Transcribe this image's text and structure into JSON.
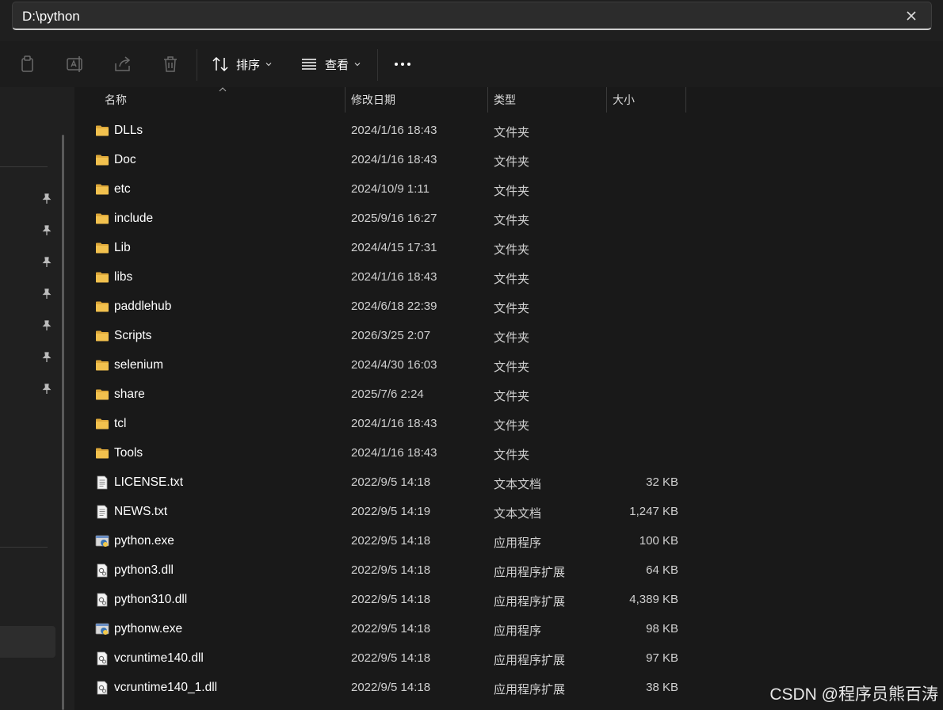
{
  "address": {
    "path": "D:\\python"
  },
  "toolbar": {
    "sort_label": "排序",
    "view_label": "查看"
  },
  "columns": [
    "名称",
    "修改日期",
    "类型",
    "大小"
  ],
  "files": [
    {
      "name": "DLLs",
      "date": "2024/1/16 18:43",
      "type": "文件夹",
      "size": "",
      "icon": "folder-icon"
    },
    {
      "name": "Doc",
      "date": "2024/1/16 18:43",
      "type": "文件夹",
      "size": "",
      "icon": "folder-icon"
    },
    {
      "name": "etc",
      "date": "2024/10/9 1:11",
      "type": "文件夹",
      "size": "",
      "icon": "folder-icon"
    },
    {
      "name": "include",
      "date": "2025/9/16 16:27",
      "type": "文件夹",
      "size": "",
      "icon": "folder-icon"
    },
    {
      "name": "Lib",
      "date": "2024/4/15 17:31",
      "type": "文件夹",
      "size": "",
      "icon": "folder-icon"
    },
    {
      "name": "libs",
      "date": "2024/1/16 18:43",
      "type": "文件夹",
      "size": "",
      "icon": "folder-icon"
    },
    {
      "name": "paddlehub",
      "date": "2024/6/18 22:39",
      "type": "文件夹",
      "size": "",
      "icon": "folder-icon"
    },
    {
      "name": "Scripts",
      "date": "2026/3/25 2:07",
      "type": "文件夹",
      "size": "",
      "icon": "folder-icon"
    },
    {
      "name": "selenium",
      "date": "2024/4/30 16:03",
      "type": "文件夹",
      "size": "",
      "icon": "folder-icon"
    },
    {
      "name": "share",
      "date": "2025/7/6 2:24",
      "type": "文件夹",
      "size": "",
      "icon": "folder-icon"
    },
    {
      "name": "tcl",
      "date": "2024/1/16 18:43",
      "type": "文件夹",
      "size": "",
      "icon": "folder-icon"
    },
    {
      "name": "Tools",
      "date": "2024/1/16 18:43",
      "type": "文件夹",
      "size": "",
      "icon": "folder-icon"
    },
    {
      "name": "LICENSE.txt",
      "date": "2022/9/5 14:18",
      "type": "文本文档",
      "size": "32 KB",
      "icon": "text-file-icon"
    },
    {
      "name": "NEWS.txt",
      "date": "2022/9/5 14:19",
      "type": "文本文档",
      "size": "1,247 KB",
      "icon": "text-file-icon"
    },
    {
      "name": "python.exe",
      "date": "2022/9/5 14:18",
      "type": "应用程序",
      "size": "100 KB",
      "icon": "python-exe-icon"
    },
    {
      "name": "python3.dll",
      "date": "2022/9/5 14:18",
      "type": "应用程序扩展",
      "size": "64 KB",
      "icon": "dll-file-icon"
    },
    {
      "name": "python310.dll",
      "date": "2022/9/5 14:18",
      "type": "应用程序扩展",
      "size": "4,389 KB",
      "icon": "dll-file-icon"
    },
    {
      "name": "pythonw.exe",
      "date": "2022/9/5 14:18",
      "type": "应用程序",
      "size": "98 KB",
      "icon": "python-exe-icon"
    },
    {
      "name": "vcruntime140.dll",
      "date": "2022/9/5 14:18",
      "type": "应用程序扩展",
      "size": "97 KB",
      "icon": "dll-file-icon"
    },
    {
      "name": "vcruntime140_1.dll",
      "date": "2022/9/5 14:18",
      "type": "应用程序扩展",
      "size": "38 KB",
      "icon": "dll-file-icon"
    }
  ],
  "watermark": "CSDN @程序员熊百涛",
  "colors": {
    "folder": "#f2c14e",
    "background": "#191919"
  }
}
